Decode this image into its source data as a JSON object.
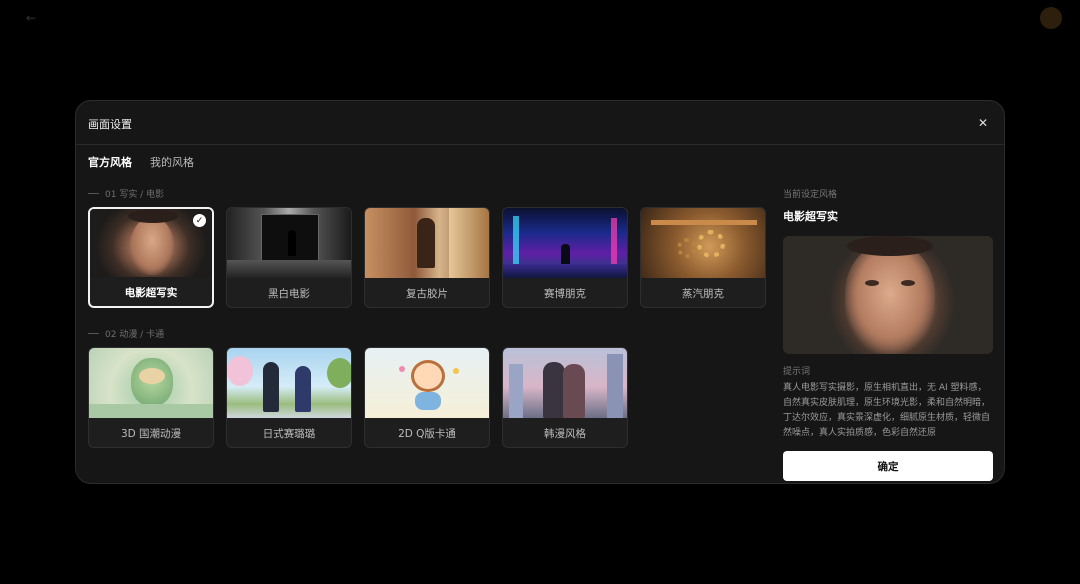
{
  "modal": {
    "title": "画面设置",
    "tabs": [
      {
        "label": "官方风格",
        "active": true
      },
      {
        "label": "我的风格",
        "active": false
      }
    ],
    "sections": [
      {
        "label": "01 写实 / 电影",
        "items": [
          {
            "label": "电影超写实",
            "selected": true
          },
          {
            "label": "黑白电影",
            "selected": false
          },
          {
            "label": "复古胶片",
            "selected": false
          },
          {
            "label": "赛博朋克",
            "selected": false
          },
          {
            "label": "蒸汽朋克",
            "selected": false
          }
        ]
      },
      {
        "label": "02 动漫 / 卡通",
        "items": [
          {
            "label": "3D 国潮动漫",
            "selected": false
          },
          {
            "label": "日式赛璐璐",
            "selected": false
          },
          {
            "label": "2D Q版卡通",
            "selected": false
          },
          {
            "label": "韩漫风格",
            "selected": false
          }
        ]
      }
    ]
  },
  "right_panel": {
    "current_label": "当前设定风格",
    "current_style": "电影超写实",
    "prompt_label": "提示词",
    "prompt_text": "真人电影写实摄影，原生相机直出，无 AI 塑料感，自然真实皮肤肌理，原生环境光影，柔和自然明暗，丁达尔效应，真实景深虚化，细腻原生材质，轻微自然噪点，真人实拍质感，色彩自然还原",
    "confirm_label": "确定"
  },
  "colors": {
    "modal_bg": "#161616",
    "accent": "#ffffff"
  }
}
